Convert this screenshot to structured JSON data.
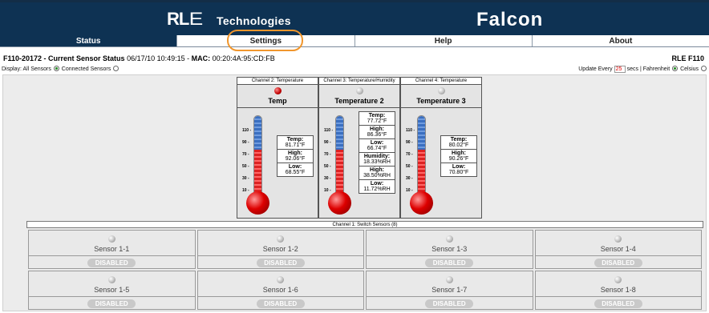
{
  "brand": {
    "rle": "RL",
    "rle_e": "E",
    "technologies": "Technologies",
    "product": "Falcon"
  },
  "nav": [
    {
      "label": "Status",
      "active": true
    },
    {
      "label": "Settings",
      "active": false
    },
    {
      "label": "Help",
      "active": false
    },
    {
      "label": "About",
      "active": false
    }
  ],
  "status": {
    "device": "F110-20172 - Current Sensor Status",
    "datetime": "06/17/10 10:49:15",
    "mac_label": "MAC:",
    "mac": "00:20:4A:95:CD:FB",
    "model": "RLE F110"
  },
  "options": {
    "display_label": "Display:",
    "all_sensors": "All Sensors",
    "connected_sensors": "Connected Sensors",
    "update_every": "Update Every",
    "update_value": "25",
    "secs": "secs",
    "separator": "|",
    "fahrenheit": "Fahrenheit",
    "celsius": "Celsius"
  },
  "channels": [
    {
      "header": "Channel 2: Temperature",
      "name": "Temp",
      "led": "red",
      "boxes": [
        [
          "Temp:",
          "81.71°F"
        ],
        [
          "High:",
          "92.06°F"
        ],
        [
          "Low:",
          "68.55°F"
        ]
      ]
    },
    {
      "header": "Channel 3: Temperature/Humidity",
      "name": "Temperature 2",
      "led": "gray",
      "boxes": [
        [
          "Temp:",
          "77.72°F"
        ],
        [
          "High:",
          "86.36°F"
        ],
        [
          "Low:",
          "66.74°F"
        ],
        [
          "Humidity:",
          "18.33%RH"
        ],
        [
          "High:",
          "38.50%RH"
        ],
        [
          "Low:",
          "11.72%RH"
        ]
      ]
    },
    {
      "header": "Channel 4: Temperature",
      "name": "Temperature 3",
      "led": "gray",
      "boxes": [
        [
          "Temp:",
          "80.02°F"
        ],
        [
          "High:",
          "90.26°F"
        ],
        [
          "Low:",
          "70.80°F"
        ]
      ]
    }
  ],
  "ticks": [
    "110 -",
    "90 -",
    "70 -",
    "50 -",
    "30 -",
    "10 -"
  ],
  "switches": {
    "header": "Channel 1: Switch Sensors (8)",
    "sensors": [
      {
        "name": "Sensor 1-1",
        "state": "DISABLED"
      },
      {
        "name": "Sensor 1-2",
        "state": "DISABLED"
      },
      {
        "name": "Sensor 1-3",
        "state": "DISABLED"
      },
      {
        "name": "Sensor 1-4",
        "state": "DISABLED"
      },
      {
        "name": "Sensor 1-5",
        "state": "DISABLED"
      },
      {
        "name": "Sensor 1-6",
        "state": "DISABLED"
      },
      {
        "name": "Sensor 1-7",
        "state": "DISABLED"
      },
      {
        "name": "Sensor 1-8",
        "state": "DISABLED"
      }
    ]
  },
  "colors": {
    "banner": "#0e3253",
    "highlight": "#f0962d",
    "alarm_led": "#c00000"
  }
}
